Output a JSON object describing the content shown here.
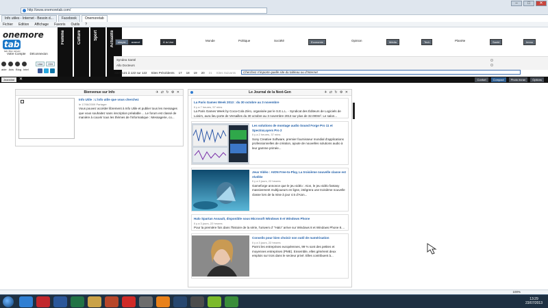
{
  "browser": {
    "url": "http://www.onemoretab.com/",
    "tabs": [
      "Info utiles - Internet - Besoin d...",
      "Facebook",
      "Onemoretab"
    ],
    "menu": [
      "Fichier",
      "Edition",
      "Affichage",
      "Favoris",
      "Outils",
      "?"
    ],
    "window_controls": [
      "–",
      "□",
      "✕"
    ],
    "zoom": "100%"
  },
  "site": {
    "logo": "onemore",
    "logo_box": "tab",
    "logo_tagline": "tab like never",
    "side_links": [
      "Votre Compte",
      "Déconnexion"
    ],
    "social_labels": [
      "aide",
      "Avis",
      "Blog",
      "Intel"
    ],
    "like_label": "Like",
    "like_count": "224",
    "vertical_tabs": [
      "Femme",
      "Culture",
      "Sport",
      "Actualité"
    ],
    "view_toggle": [
      "simple",
      "avancé"
    ],
    "nav": [
      {
        "label": "À la Une",
        "style": "pill-dark"
      },
      {
        "label": "Monde",
        "style": "text"
      },
      {
        "label": "Politique",
        "style": "text"
      },
      {
        "label": "Société",
        "style": "text"
      },
      {
        "label": "Economie",
        "style": "pill"
      },
      {
        "label": "Opinion",
        "style": "text"
      },
      {
        "label": "Média",
        "style": "pill"
      },
      {
        "label": "Tech",
        "style": "pill"
      },
      {
        "label": "Planète",
        "style": "text"
      },
      {
        "label": "Santé",
        "style": "pill"
      },
      {
        "label": "Immo",
        "style": "pill"
      }
    ],
    "list_rows": [
      "Syndea Santé",
      "Allo Docteurs"
    ],
    "pager": {
      "label": "Sites 121 à 122 sur 122",
      "prev": "Sites Précédents",
      "pages": [
        "17",
        "18",
        "19",
        "20",
        "21"
      ],
      "next": "Sites Suivants"
    },
    "search_placeholder": "Cherchez n'importe quelle site du tableau ou d'Internet",
    "black_bar": {
      "left_tab": "Jeannine",
      "right_buttons": [
        "Confort",
        "Compact",
        "Photo écran",
        "Options"
      ],
      "active_right": "Compact"
    }
  },
  "widgets": {
    "info": {
      "title": "Bienvenue sur Info",
      "tools": "✈ ⇄ ↻ ⚙ ✕",
      "link": "Info Utile : L'info utile que vous cherchez",
      "date": "le 17/06/2009",
      "partager": "Partager",
      "body": "Vous pouvez accéder librement à Info Utile et publier tous les messages que vous souhaitez sans inscription préalable ... Le forum est classé de manière à couvrir tous les thèmes de l'informatique : Messagerie, co..."
    },
    "journal": {
      "title": "Le Journal de la Next-Gen",
      "tools": "✈ ⇄ ↻ ⚙ ✕",
      "articles": [
        {
          "title": "La Paris Games Week 2013 : du 30 octobre au 3 novembre",
          "meta": "Il y a 7 heures, 57 mins",
          "body": "La Paris Games Week by Coca-Cola Zéro, organisée par le S.E.L.L. - Syndicat des Éditeurs de Logiciels de Loisirs, aura lieu porte de Versailles du 30 octobre au 3 novembre 2013 sur plus de 32.000m². Le salon...",
          "has_thumb": false
        },
        {
          "title": "Les solutions de montage audio Sound Forge Pro 11 et SpectraLayers Pro 2",
          "meta": "Il y a 2 heures, 37 mins",
          "body": "Sony Creative Software, premier fournisseur mondial d'applications professionnelles de création, ajoute de nouvelles solutions audio à leur gamme primée...",
          "has_thumb": true
        },
        {
          "title": "Jeux Vidéo : AION Free-to-Play, La troisième nouvelle classe est révélée",
          "meta": "Il y a 3 jours, 22 heures",
          "body": "Gameforge annonce que le jeu vidéo : Aion, le jeu vidéo fantasy massivement multijoueurs en ligne, intégrera une troisième nouvelle classe lors de la mise à jour 4.5 d'Aion...",
          "has_thumb": true
        },
        {
          "title": "Halo Spartan Assault, disponible sous Microsoft Windows 8 et Windows Phone",
          "meta": "Il y a 3 jours, 22 heures",
          "body": "Pour la première fois dans l'histoire de la série, l'univers d' \"Halo\" arrive sur Windows 8 et Windows Phone 8....",
          "has_thumb": false
        },
        {
          "title": "Conseils pour bien choisir son outil de numérisation",
          "meta": "Il y a 3 jours, 22 heures",
          "body": "Parmi les entreprises européennes, 99 % sont des petites et moyennes entreprises (PME). Ensemble, elles génèrent deux emplois sur trois dans le secteur privé. Elles contribuent à...",
          "has_thumb": true
        }
      ]
    }
  },
  "taskbar": {
    "time": "13:29",
    "date": "23/07/2013"
  },
  "colors": {
    "taskbar": "#1e3042",
    "link": "#1f5ea8",
    "black_bar": "#121212"
  }
}
